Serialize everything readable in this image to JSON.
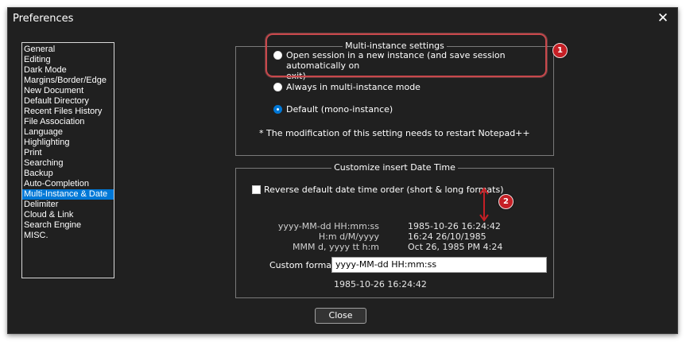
{
  "window": {
    "title": "Preferences",
    "close_glyph": "✕"
  },
  "sidebar": {
    "items": [
      {
        "label": "General"
      },
      {
        "label": "Editing"
      },
      {
        "label": "Dark Mode"
      },
      {
        "label": "Margins/Border/Edge"
      },
      {
        "label": "New Document"
      },
      {
        "label": "Default Directory"
      },
      {
        "label": "Recent Files History"
      },
      {
        "label": "File Association"
      },
      {
        "label": "Language"
      },
      {
        "label": "Highlighting"
      },
      {
        "label": "Print"
      },
      {
        "label": "Searching"
      },
      {
        "label": "Backup"
      },
      {
        "label": "Auto-Completion"
      },
      {
        "label": "Multi-Instance & Date"
      },
      {
        "label": "Delimiter"
      },
      {
        "label": "Cloud & Link"
      },
      {
        "label": "Search Engine"
      },
      {
        "label": "MISC."
      }
    ],
    "selected": "Multi-Instance & Date"
  },
  "multi_instance": {
    "title": "Multi-instance settings",
    "options": [
      {
        "label_line1": "Open session in a new instance (and save session automatically on",
        "label_line2": "exit)",
        "checked": false
      },
      {
        "label": "Always in multi-instance mode",
        "checked": false
      },
      {
        "label": "Default (mono-instance)",
        "checked": true
      }
    ],
    "note": "* The modification of this setting needs to restart Notepad++"
  },
  "date_time": {
    "title": "Customize insert Date Time",
    "reverse_label": "Reverse default date time order (short & long formats)",
    "reverse_checked": false,
    "formats": [
      {
        "pattern": "yyyy-MM-dd HH:mm:ss",
        "example": "1985-10-26 16:24:42"
      },
      {
        "pattern": "H:m d/M/yyyy",
        "example": "16:24 26/10/1985"
      },
      {
        "pattern": "MMM d, yyyy  tt h:m",
        "example": "Oct 26, 1985  PM 4:24"
      }
    ],
    "custom_label": "Custom format:",
    "custom_value": "yyyy-MM-dd HH:mm:ss",
    "preview": "1985-10-26 16:24:42"
  },
  "buttons": {
    "close_label": "Close"
  },
  "annotations": {
    "badge1": "1",
    "badge2": "2",
    "color": "#c51f25"
  },
  "colors": {
    "background": "#202020",
    "selection": "#0078d7",
    "annotation": "#c8484c"
  }
}
